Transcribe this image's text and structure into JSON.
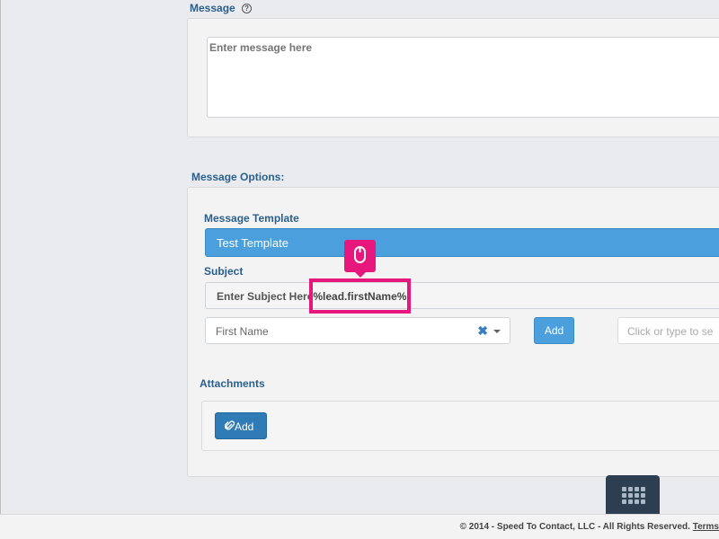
{
  "message": {
    "label": "Message",
    "help_icon": "?",
    "placeholder": "Enter message here"
  },
  "options": {
    "label": "Message Options:",
    "template_label": "Message Template",
    "template_value": "Test Template",
    "subject_label": "Subject",
    "subject_text": "Enter Subject Here",
    "subject_variable": "%lead.firstName%",
    "field_select_value": "First Name",
    "clear_icon": "✖",
    "add_label": "Add",
    "tag_placeholder": "Click or type to se"
  },
  "attachments": {
    "label": "Attachments",
    "add_label": "Add"
  },
  "footer": {
    "copyright": "© 2014 - Speed To Contact, LLC - All Rights Reserved.",
    "terms_link": "Terms"
  },
  "icons": {
    "mouse": "mouse-icon",
    "paperclip": "paperclip-icon",
    "grid": "grid-menu-icon"
  },
  "colors": {
    "accent_blue": "#4a9fdc",
    "highlight_pink": "#e8177d",
    "label_blue": "#2a5f8e",
    "dark_nav": "#2d3e50"
  }
}
